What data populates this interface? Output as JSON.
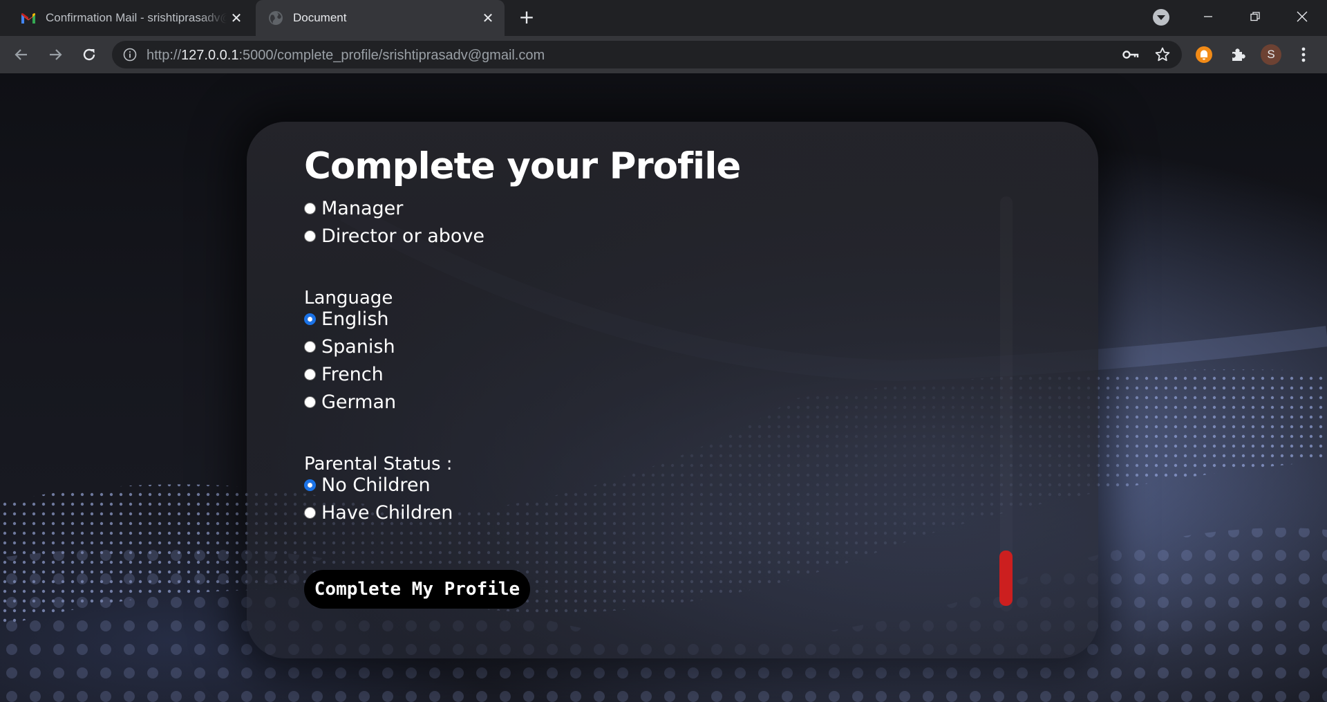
{
  "browser": {
    "tabs": [
      {
        "title": "Confirmation Mail - srishtiprasadv@gmail.com",
        "icon": "gmail-icon",
        "active": false
      },
      {
        "title": "Document",
        "icon": "globe-icon",
        "active": true
      }
    ],
    "new_tab_label": "+",
    "url": {
      "scheme": "http://",
      "host": "127.0.0.1",
      "rest": ":5000/complete_profile/srishtiprasadv@gmail.com"
    },
    "profile_initial": "S",
    "close_glyph": "✕"
  },
  "page": {
    "title": "Complete your Profile",
    "role_options": [
      {
        "label": "Manager",
        "checked": false
      },
      {
        "label": "Director or above",
        "checked": false
      }
    ],
    "language": {
      "label": "Language",
      "options": [
        {
          "label": "English",
          "checked": true
        },
        {
          "label": "Spanish",
          "checked": false
        },
        {
          "label": "French",
          "checked": false
        },
        {
          "label": "German",
          "checked": false
        }
      ]
    },
    "parental": {
      "label": "Parental Status :",
      "options": [
        {
          "label": "No Children",
          "checked": true
        },
        {
          "label": "Have Children",
          "checked": false
        }
      ]
    },
    "submit_label": "Complete My Profile"
  },
  "colors": {
    "accent_radio": "#1a73e8",
    "scrollbar_thumb": "#cc1f1f",
    "card_bg": "#24242a"
  }
}
